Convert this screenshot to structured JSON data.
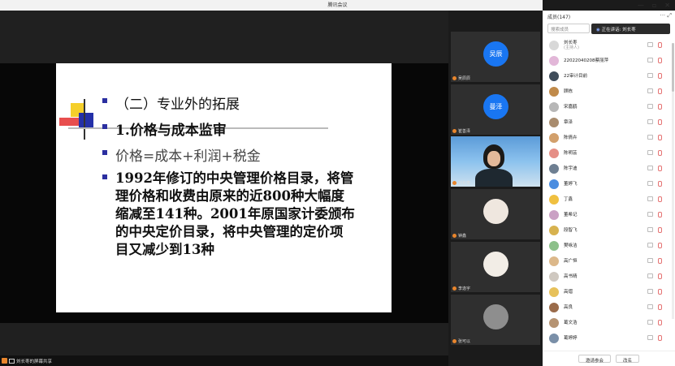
{
  "window": {
    "title": "腾讯会议",
    "controls": [
      "—",
      "▫",
      "✕"
    ]
  },
  "slide": {
    "heading": "（二）专业外的拓展",
    "subheading": "1.价格与成本监审",
    "formula": "价格=成本+利润+税金",
    "body_lines": [
      "1992年修订的中央管理价格目录，将管",
      "理价格和收费由原来的近800种大幅度",
      "缩减至141种。2001年原国家计委颁布",
      "的中央定价目录，将中央管理的定价项",
      "目又减少到13种"
    ]
  },
  "share_tag": "刘长枣的屏幕共享",
  "video_tiles": [
    {
      "name": "吴辰辰",
      "kind": "avatar",
      "avatar_text": "吴辰"
    },
    {
      "name": "崔善泽",
      "kind": "avatar",
      "avatar_text": "曼泽"
    },
    {
      "name": "刘长枣",
      "kind": "camera"
    },
    {
      "name": "钟鑫",
      "kind": "photo"
    },
    {
      "name": "李逸宇",
      "kind": "photo"
    },
    {
      "name": "张可以",
      "kind": "photo"
    }
  ],
  "panel": {
    "title": "成员(147)",
    "tools": "··· ⤢",
    "search_placeholder": "搜索成员",
    "speaking_label": "正在讲话: 刘长枣",
    "members": [
      {
        "name": "刘长枣",
        "role": "(主持人)",
        "color": "#d8d8d8"
      },
      {
        "name": "22022040208蔡丽萍",
        "role": "",
        "color": "#e2b7d8"
      },
      {
        "name": "22审计目前",
        "role": "",
        "color": "#3f4c5a"
      },
      {
        "name": "顾栋",
        "role": "",
        "color": "#c08a4a"
      },
      {
        "name": "宋嘉鹤",
        "role": "",
        "color": "#b7b7b7"
      },
      {
        "name": "章泽",
        "role": "",
        "color": "#a98c6e"
      },
      {
        "name": "陈倩卉",
        "role": "",
        "color": "#d2a06c"
      },
      {
        "name": "陈明芸",
        "role": "",
        "color": "#e58f86"
      },
      {
        "name": "陈宇迪",
        "role": "",
        "color": "#6e7f92"
      },
      {
        "name": "董婷飞",
        "role": "",
        "color": "#4b8de0"
      },
      {
        "name": "丁鑫",
        "role": "",
        "color": "#f0c040"
      },
      {
        "name": "董希记",
        "role": "",
        "color": "#caa1c4"
      },
      {
        "name": "段智飞",
        "role": "",
        "color": "#d7b24f"
      },
      {
        "name": "樊咏洁",
        "role": "",
        "color": "#8cc08a"
      },
      {
        "name": "高广恒",
        "role": "",
        "color": "#dcb88a"
      },
      {
        "name": "高书晴",
        "role": "",
        "color": "#cfc8c0"
      },
      {
        "name": "高熠",
        "role": "",
        "color": "#e7c15a"
      },
      {
        "name": "高良",
        "role": "",
        "color": "#9a6b4a"
      },
      {
        "name": "葛文浩",
        "role": "",
        "color": "#b59372"
      },
      {
        "name": "葛婷婷",
        "role": "",
        "color": "#7a8fa8"
      }
    ],
    "footer_buttons": [
      "邀请参会",
      "改名"
    ]
  }
}
